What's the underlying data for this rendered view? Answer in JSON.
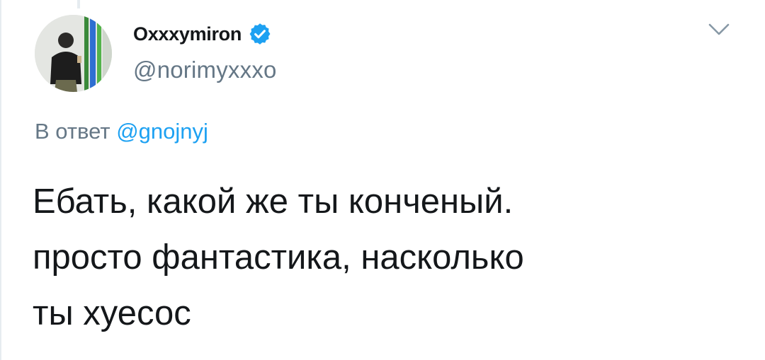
{
  "tweet": {
    "author": {
      "display_name": "Oxxxymiron",
      "handle": "@norimyxxxo",
      "verified": true,
      "verified_color": "#1da1f2"
    },
    "reply_prefix": "В ответ",
    "reply_mention": "@gnojnyj",
    "text_lines": [
      "Ебать, какой же ты конченый.",
      "просто фантастика, насколько",
      "ты хуесос"
    ],
    "menu_icon": "chevron-down-icon",
    "colors": {
      "text": "#14171a",
      "secondary": "#657786",
      "link": "#1da1f2"
    }
  }
}
